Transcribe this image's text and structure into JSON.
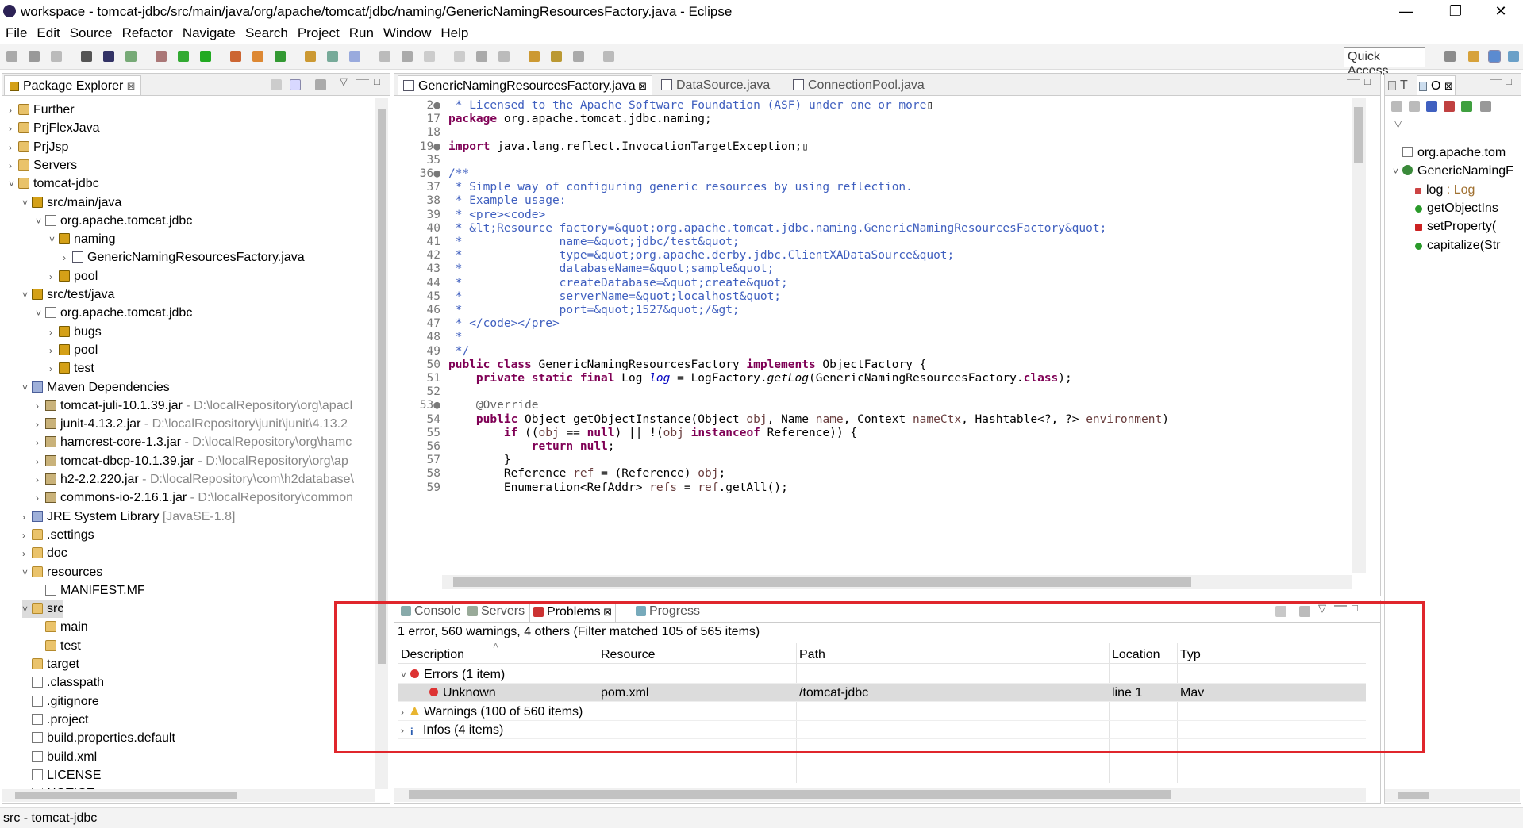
{
  "window": {
    "title": "workspace - tomcat-jdbc/src/main/java/org/apache/tomcat/jdbc/naming/GenericNamingResourcesFactory.java - Eclipse",
    "minimize": "—",
    "maximize": "❐",
    "close": "✕"
  },
  "menu": [
    "File",
    "Edit",
    "Source",
    "Refactor",
    "Navigate",
    "Search",
    "Project",
    "Run",
    "Window",
    "Help"
  ],
  "toolbar": {
    "quick_access": "Quick Access"
  },
  "package_explorer": {
    "title": "Package Explorer",
    "items": [
      {
        "label": "Further",
        "twisty": "›",
        "icon": "proj",
        "indent": 0
      },
      {
        "label": "PrjFlexJava",
        "twisty": "›",
        "icon": "proj",
        "indent": 0
      },
      {
        "label": "PrjJsp",
        "twisty": "›",
        "icon": "proj",
        "indent": 0
      },
      {
        "label": "Servers",
        "twisty": "›",
        "icon": "folder",
        "indent": 0
      },
      {
        "label": "tomcat-jdbc",
        "twisty": "˅",
        "icon": "proj",
        "indent": 0
      },
      {
        "label": "src/main/java",
        "twisty": "˅",
        "icon": "pkg",
        "indent": 1
      },
      {
        "label": "org.apache.tomcat.jdbc",
        "twisty": "˅",
        "icon": "pkgw",
        "indent": 2
      },
      {
        "label": "naming",
        "twisty": "˅",
        "icon": "pkg",
        "indent": 3
      },
      {
        "label": "GenericNamingResourcesFactory.java",
        "twisty": "›",
        "icon": "java",
        "indent": 4
      },
      {
        "label": "pool",
        "twisty": "›",
        "icon": "pkg",
        "indent": 3
      },
      {
        "label": "src/test/java",
        "twisty": "˅",
        "icon": "pkg",
        "indent": 1
      },
      {
        "label": "org.apache.tomcat.jdbc",
        "twisty": "˅",
        "icon": "pkgw",
        "indent": 2
      },
      {
        "label": "bugs",
        "twisty": "›",
        "icon": "pkg",
        "indent": 3
      },
      {
        "label": "pool",
        "twisty": "›",
        "icon": "pkg",
        "indent": 3
      },
      {
        "label": "test",
        "twisty": "›",
        "icon": "pkg",
        "indent": 3
      },
      {
        "label": "Maven Dependencies",
        "twisty": "˅",
        "icon": "lib",
        "indent": 1
      },
      {
        "label": "tomcat-juli-10.1.39.jar",
        "suffix": " - D:\\localRepository\\org\\apacl",
        "twisty": "›",
        "icon": "jar",
        "indent": 2
      },
      {
        "label": "junit-4.13.2.jar",
        "suffix": " - D:\\localRepository\\junit\\junit\\4.13.2",
        "twisty": "›",
        "icon": "jar",
        "indent": 2
      },
      {
        "label": "hamcrest-core-1.3.jar",
        "suffix": " - D:\\localRepository\\org\\hamc",
        "twisty": "›",
        "icon": "jar",
        "indent": 2
      },
      {
        "label": "tomcat-dbcp-10.1.39.jar",
        "suffix": " - D:\\localRepository\\org\\ap",
        "twisty": "›",
        "icon": "jar",
        "indent": 2
      },
      {
        "label": "h2-2.2.220.jar",
        "suffix": " - D:\\localRepository\\com\\h2database\\",
        "twisty": "›",
        "icon": "jar",
        "indent": 2
      },
      {
        "label": "commons-io-2.16.1.jar",
        "suffix": " - D:\\localRepository\\common",
        "twisty": "›",
        "icon": "jar",
        "indent": 2
      },
      {
        "label": "JRE System Library",
        "suffix": " [JavaSE-1.8]",
        "twisty": "›",
        "icon": "lib",
        "indent": 1
      },
      {
        "label": ".settings",
        "twisty": "›",
        "icon": "folder",
        "indent": 1
      },
      {
        "label": "doc",
        "twisty": "›",
        "icon": "folder",
        "indent": 1
      },
      {
        "label": "resources",
        "twisty": "˅",
        "icon": "folder",
        "indent": 1
      },
      {
        "label": "MANIFEST.MF",
        "twisty": "",
        "icon": "file",
        "indent": 2
      },
      {
        "label": "src",
        "twisty": "˅",
        "icon": "folder",
        "indent": 1,
        "selected": true
      },
      {
        "label": "main",
        "twisty": "",
        "icon": "folder",
        "indent": 2
      },
      {
        "label": "test",
        "twisty": "",
        "icon": "folder",
        "indent": 2
      },
      {
        "label": "target",
        "twisty": "",
        "icon": "folder",
        "indent": 1
      },
      {
        "label": ".classpath",
        "twisty": "",
        "icon": "file",
        "indent": 1
      },
      {
        "label": ".gitignore",
        "twisty": "",
        "icon": "file",
        "indent": 1
      },
      {
        "label": ".project",
        "twisty": "",
        "icon": "file",
        "indent": 1
      },
      {
        "label": "build.properties.default",
        "twisty": "",
        "icon": "file",
        "indent": 1
      },
      {
        "label": "build.xml",
        "twisty": "",
        "icon": "file",
        "indent": 1
      },
      {
        "label": "LICENSE",
        "twisty": "",
        "icon": "file",
        "indent": 1
      },
      {
        "label": "NOTICE",
        "twisty": "",
        "icon": "file",
        "indent": 1
      }
    ]
  },
  "editor": {
    "tabs": [
      "GenericNamingResourcesFactory.java",
      "DataSource.java",
      "ConnectionPool.java"
    ],
    "lines": [
      {
        "n": "2●",
        "html": "<span class=\"cm\"> * Licensed to the Apache Software Foundation (ASF) under one or more</span>▯"
      },
      {
        "n": "17",
        "html": "<span class=\"kw\">package</span> org.apache.tomcat.jdbc.naming;"
      },
      {
        "n": "18",
        "html": ""
      },
      {
        "n": "19●",
        "html": "<span class=\"kw\">import</span> java.lang.reflect.InvocationTargetException;▯"
      },
      {
        "n": "35",
        "html": ""
      },
      {
        "n": "36●",
        "html": "<span class=\"cm\">/**</span>"
      },
      {
        "n": "37",
        "html": "<span class=\"cm\"> * Simple way of configuring generic resources by using reflection.</span>"
      },
      {
        "n": "38",
        "html": "<span class=\"cm\"> * Example usage:</span>"
      },
      {
        "n": "39",
        "html": "<span class=\"cm\"> * &lt;pre&gt;&lt;code&gt;</span>"
      },
      {
        "n": "40",
        "html": "<span class=\"cm\"> * &amp;lt;Resource factory=&amp;quot;org.apache.tomcat.jdbc.naming.GenericNamingResourcesFactory&amp;quot;</span>"
      },
      {
        "n": "41",
        "html": "<span class=\"cm\"> *              name=&amp;quot;jdbc/test&amp;quot;</span>"
      },
      {
        "n": "42",
        "html": "<span class=\"cm\"> *              type=&amp;quot;org.apache.derby.jdbc.ClientXADataSource&amp;quot;</span>"
      },
      {
        "n": "43",
        "html": "<span class=\"cm\"> *              databaseName=&amp;quot;sample&amp;quot;</span>"
      },
      {
        "n": "44",
        "html": "<span class=\"cm\"> *              createDatabase=&amp;quot;create&amp;quot;</span>"
      },
      {
        "n": "45",
        "html": "<span class=\"cm\"> *              serverName=&amp;quot;localhost&amp;quot;</span>"
      },
      {
        "n": "46",
        "html": "<span class=\"cm\"> *              port=&amp;quot;1527&amp;quot;/&amp;gt;</span>"
      },
      {
        "n": "47",
        "html": "<span class=\"cm\"> * &lt;/code&gt;&lt;/pre&gt;</span>"
      },
      {
        "n": "48",
        "html": "<span class=\"cm\"> *</span>"
      },
      {
        "n": "49",
        "html": "<span class=\"cm\"> */</span>"
      },
      {
        "n": "50",
        "html": "<span class=\"kw\">public class</span> GenericNamingResourcesFactory <span class=\"kw\">implements</span> ObjectFactory {"
      },
      {
        "n": "51",
        "html": "    <span class=\"kw\">private static final</span> Log <span class=\"fld it\">log</span> = LogFactory.<span class=\"it\">getLog</span>(GenericNamingResourcesFactory.<span class=\"kw\">class</span>);"
      },
      {
        "n": "52",
        "html": ""
      },
      {
        "n": "53●",
        "html": "    <span class=\"an\">@Override</span>"
      },
      {
        "n": "54",
        "html": "    <span class=\"kw\">public</span> Object getObjectInstance(Object <span class=\"prm\">obj</span>, Name <span class=\"prm\">name</span>, Context <span class=\"prm\">nameCtx</span>, Hashtable&lt;?, ?&gt; <span class=\"prm\">environment</span>)"
      },
      {
        "n": "55",
        "html": "        <span class=\"kw\">if</span> ((<span class=\"prm\">obj</span> == <span class=\"kw\">null</span>) || !(<span class=\"prm\">obj</span> <span class=\"kw\">instanceof</span> Reference)) {"
      },
      {
        "n": "56",
        "html": "            <span class=\"kw\">return null</span>;"
      },
      {
        "n": "57",
        "html": "        }"
      },
      {
        "n": "58",
        "html": "        Reference <span class=\"prm\">ref</span> = (Reference) <span class=\"prm\">obj</span>;"
      },
      {
        "n": "59",
        "html": "        Enumeration&lt;RefAddr&gt; <span class=\"prm\">refs</span> = <span class=\"prm\">ref</span>.getAll();"
      }
    ]
  },
  "outline": {
    "tabs": [
      "T",
      "O"
    ],
    "items": [
      {
        "label": "org.apache.tom",
        "twisty": "",
        "icon": "pkgw"
      },
      {
        "label": "GenericNamingF",
        "twisty": "˅",
        "icon": "class"
      },
      {
        "label": "log",
        "suffix": " : Log",
        "icon": "field"
      },
      {
        "label": "getObjectIns",
        "icon": "method"
      },
      {
        "label": "setProperty(",
        "icon": "smethod"
      },
      {
        "label": "capitalize(Str",
        "icon": "method"
      }
    ]
  },
  "bottom": {
    "tabs": [
      "Console",
      "Servers",
      "Problems",
      "Progress"
    ],
    "active_tab": "Problems",
    "summary": "1 error, 560 warnings, 4 others (Filter matched 105 of 565 items)",
    "columns": [
      "Description",
      "Resource",
      "Path",
      "Location",
      "Typ"
    ],
    "rows": [
      {
        "twisty": "˅",
        "icon": "error",
        "description": "Errors (1 item)",
        "resource": "",
        "path": "",
        "location": "",
        "type": "",
        "indent": 0
      },
      {
        "twisty": "",
        "icon": "error",
        "description": "Unknown",
        "resource": "pom.xml",
        "path": "/tomcat-jdbc",
        "location": "line 1",
        "type": "Mav",
        "indent": 1,
        "selected": true
      },
      {
        "twisty": "›",
        "icon": "warning",
        "description": "Warnings (100 of 560 items)",
        "resource": "",
        "path": "",
        "location": "",
        "type": "",
        "indent": 0
      },
      {
        "twisty": "›",
        "icon": "info",
        "description": "Infos (4 items)",
        "resource": "",
        "path": "",
        "location": "",
        "type": "",
        "indent": 0
      }
    ]
  },
  "status": {
    "text": "src - tomcat-jdbc"
  },
  "colors": {
    "highlight": "#e0262c",
    "selection": "#dcdcdc",
    "keyword": "#7f0055",
    "comment": "#3f5fbf"
  }
}
